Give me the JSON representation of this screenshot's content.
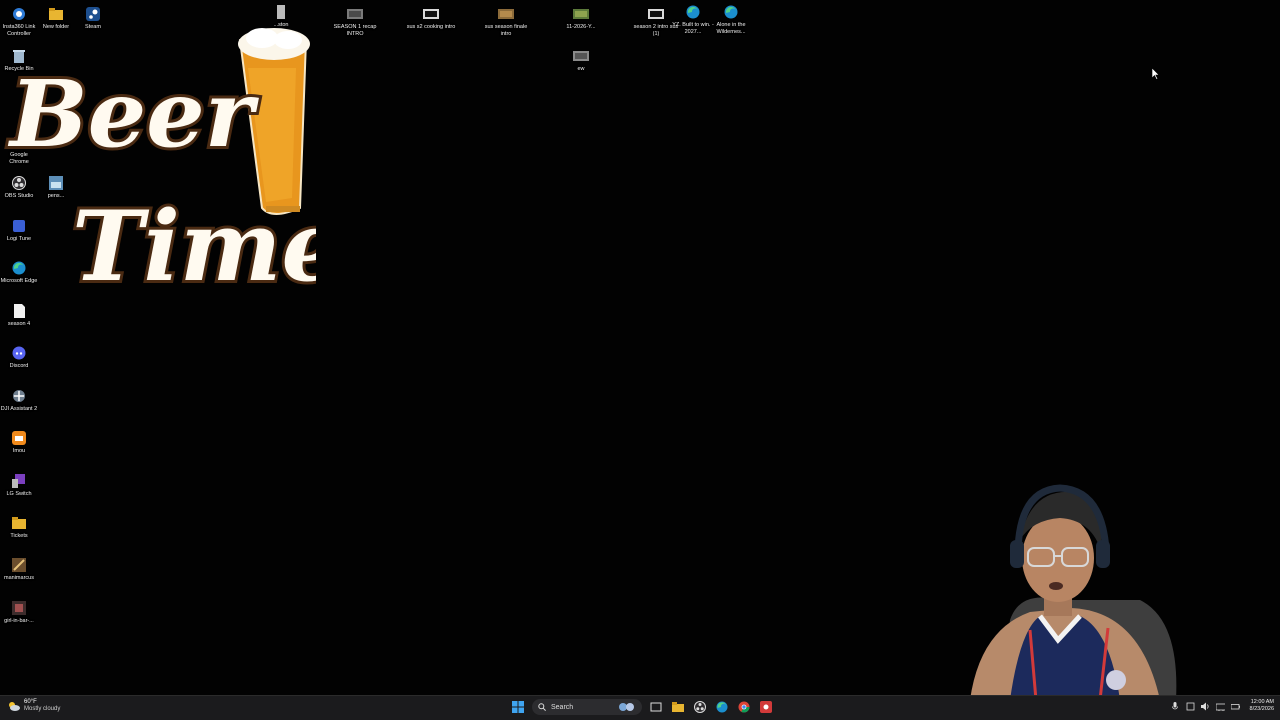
{
  "desktop": {
    "icons_left": [
      {
        "label": "Insta360 Link Controller",
        "icon": "camera-icon"
      },
      {
        "label": "New folder",
        "icon": "folder-icon"
      },
      {
        "label": "Steam",
        "icon": "steam-icon"
      },
      {
        "label": "Recycle Bin",
        "icon": "recycle-bin-icon"
      },
      {
        "label": "Google Chrome",
        "icon": "chrome-icon"
      },
      {
        "label": "OBS Studio",
        "icon": "obs-icon"
      },
      {
        "label": "pens...",
        "icon": "image-icon"
      },
      {
        "label": "Logi Tune",
        "icon": "logi-icon"
      },
      {
        "label": "Microsoft Edge",
        "icon": "edge-icon"
      },
      {
        "label": "season 4",
        "icon": "document-icon"
      },
      {
        "label": "Discord",
        "icon": "discord-icon"
      },
      {
        "label": "DJI Assistant 2",
        "icon": "dji-icon"
      },
      {
        "label": "Imou",
        "icon": "imou-icon"
      },
      {
        "label": "LG Switch",
        "icon": "lg-switch-icon"
      },
      {
        "label": "Tickets",
        "icon": "folder-icon"
      },
      {
        "label": "manimarcus",
        "icon": "shortcut-icon"
      },
      {
        "label": "girl-in-bar-...",
        "icon": "image-icon"
      }
    ],
    "icons_top": [
      {
        "label": "...ston",
        "icon": "file-icon"
      },
      {
        "label": "SEASON 1 recap INTRO",
        "icon": "video-icon"
      },
      {
        "label": "sus s2 cooking intro",
        "icon": "video-icon"
      },
      {
        "label": "sus season finale intro",
        "icon": "video-icon"
      },
      {
        "label": "11-2026-Y...",
        "icon": "video-icon"
      },
      {
        "label": "ew",
        "icon": "video-icon"
      },
      {
        "label": "season 2 intro sus (1)",
        "icon": "video-icon"
      },
      {
        "label": "YZ. Built to win. - 2027...",
        "icon": "edge-icon"
      },
      {
        "label": "Alone in the Wildernes...",
        "icon": "edge-icon"
      }
    ],
    "overlay": {
      "line1": "Beer",
      "line2": "Time"
    }
  },
  "taskbar": {
    "weather_temp": "60°F",
    "weather_desc": "Mostly cloudy",
    "search_placeholder": "Search",
    "clock_time": "12:00 AM",
    "clock_date": "8/23/2026"
  },
  "colors": {
    "taskbar_bg": "#1b1b1d",
    "desktop_bg": "#020202",
    "beer_amber": "#e8961e",
    "text_outline": "#4a2a12"
  }
}
